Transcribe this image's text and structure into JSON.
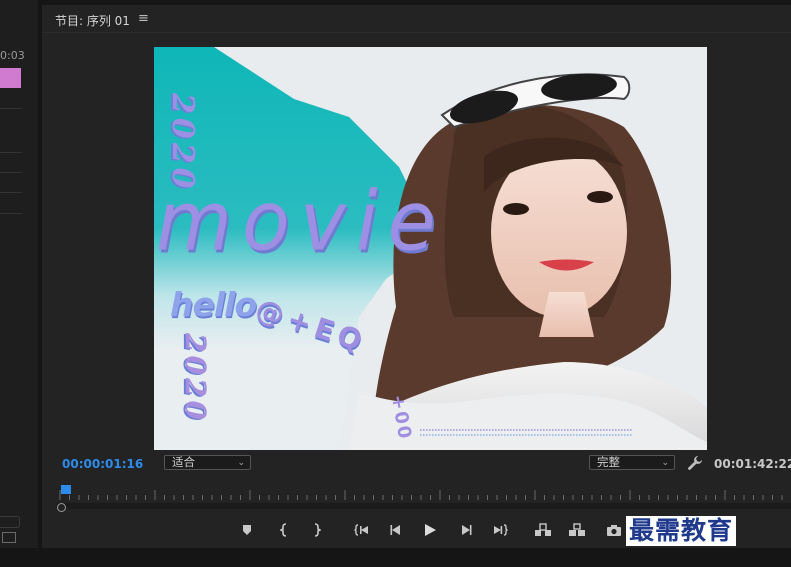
{
  "left_panel": {
    "timecode_fragment": "0:03"
  },
  "monitor": {
    "title": "节目: 序列 01",
    "menu_icon": "hamburger-menu-icon",
    "current_time": "00:00:01:16",
    "duration": "00:01:42:22",
    "fit_select": {
      "value": "适合"
    },
    "quality_select": {
      "value": "完整"
    },
    "settings_icon": "wrench-icon",
    "controls": [
      "add-marker-icon",
      "mark-in-icon",
      "mark-out-icon",
      "go-to-in-icon",
      "step-back-icon",
      "play-icon",
      "step-forward-icon",
      "go-to-out-icon",
      "lift-icon",
      "extract-icon",
      "export-frame-icon",
      "comparison-view-icon"
    ]
  },
  "video_frame": {
    "texts": {
      "year_vertical": "2020",
      "big_word": "movie",
      "hello": "hello",
      "year_lower": "2020",
      "curve_text": "@+EQ",
      "small_curve": "+00"
    },
    "colors": {
      "teal": "#12b9b9",
      "lavender": "#9d8fe3",
      "background": "#eceff0"
    }
  },
  "watermark": "最需教育"
}
